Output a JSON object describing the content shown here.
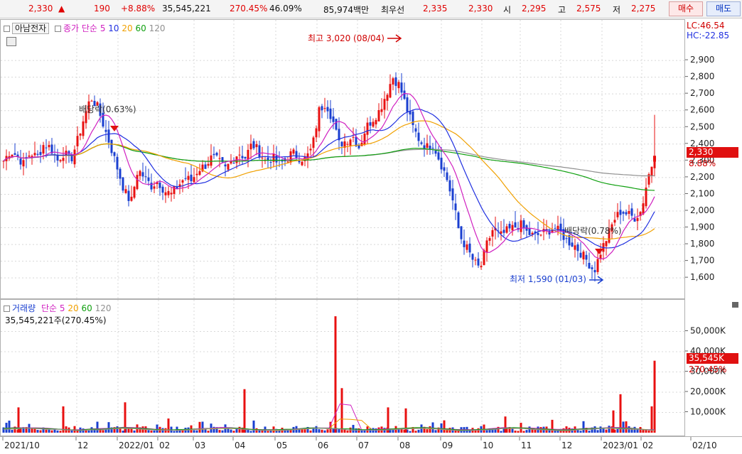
{
  "quote": {
    "price": "2,330",
    "arrow": "▲",
    "change": "190",
    "change_pct": "+8.88%",
    "volume": "35,545,221",
    "volume_ratio": "270.45%",
    "turnover_pct": "46.09%",
    "amount": "85,974백만",
    "best_ask_label": "최우선",
    "best_ask": "2,335",
    "best_bid": "2,330",
    "open_label": "시",
    "open": "2,295",
    "high_label": "고",
    "high": "2,575",
    "low_label": "저",
    "low": "2,275",
    "buy_button": "매수",
    "sell_button": "매도"
  },
  "price_pane": {
    "stock_name": "아남전자",
    "ma_label": "종가 단순",
    "ma_periods": [
      "5",
      "10",
      "20",
      "60",
      "120"
    ],
    "lc_text": "LC:46.54",
    "hc_text": "HC:-22.85",
    "high_marker": "최고 3,020 (08/04)",
    "low_marker": "최저 1,590 (01/03)",
    "dividend_1": "배당락(0.63%)",
    "dividend_2": "배당락(0.78%)",
    "current_price_tag": "2,330",
    "current_pct_tag": "8.88%"
  },
  "volume_pane": {
    "title": "거래량",
    "ma_label": "단순",
    "ma_periods": [
      "5",
      "20",
      "60",
      "120"
    ],
    "summary": "35,545,221주(270.45%)",
    "current_tag": "35,545K",
    "current_pct_tag": "270.45%"
  },
  "x_axis": {
    "labels": [
      "2021/10",
      "12",
      "2022/01",
      "02",
      "03",
      "04",
      "05",
      "06",
      "07",
      "08",
      "09",
      "10",
      "11",
      "12",
      "2023/01",
      "02",
      "02/10"
    ]
  },
  "colors": {
    "up": "#e81010",
    "down": "#1a3fd0",
    "ma5": "#d020c0",
    "ma10": "#2030e0",
    "ma20": "#f0a000",
    "ma60": "#10a010",
    "ma120": "#909090"
  },
  "chart_data": {
    "type": "candlestick",
    "y_ticks": [
      "2,900",
      "2,800",
      "2,700",
      "2,600",
      "2,500",
      "2,400",
      "2,300",
      "2,200",
      "2,100",
      "2,000",
      "1,900",
      "1,800",
      "1,700",
      "1,600"
    ],
    "ylim": [
      1520,
      3100
    ],
    "close_path": [
      2300,
      2360,
      2330,
      2280,
      2350,
      2320,
      2400,
      2380,
      2300,
      2350,
      2300,
      2420,
      2560,
      2680,
      2620,
      2500,
      2380,
      2250,
      2120,
      2050,
      2250,
      2200,
      2150,
      2180,
      2120,
      2100,
      2150,
      2200,
      2180,
      2250,
      2270,
      2320,
      2300,
      2250,
      2300,
      2350,
      2320,
      2400,
      2360,
      2300,
      2320,
      2280,
      2300,
      2350,
      2320,
      2310,
      2380,
      2600,
      2650,
      2550,
      2400,
      2420,
      2450,
      2380,
      2500,
      2550,
      2600,
      2700,
      2800,
      2750,
      2620,
      2500,
      2420,
      2380,
      2400,
      2300,
      2200,
      2050,
      1850,
      1780,
      1700,
      1650,
      1800,
      1900,
      1850,
      1880,
      1900,
      1920,
      1870,
      1850,
      1860,
      1880,
      1900,
      1870,
      1820,
      1800,
      1750,
      1700,
      1640,
      1760,
      1850,
      1950,
      2000,
      1980,
      1960,
      2000,
      2200,
      2330
    ],
    "volume_ticks": [
      "50,000K",
      "40,000K",
      "30,000K",
      "20,000K",
      "10,000K"
    ],
    "volume_ylim": [
      0,
      60000
    ],
    "volume_spikes": [
      {
        "x": 25,
        "v": 12500
      },
      {
        "x": 88,
        "v": 13000
      },
      {
        "x": 175,
        "v": 15000
      },
      {
        "x": 236,
        "v": 7000
      },
      {
        "x": 343,
        "v": 21500
      },
      {
        "x": 471,
        "v": 57500
      },
      {
        "x": 480,
        "v": 22000
      },
      {
        "x": 545,
        "v": 12500
      },
      {
        "x": 570,
        "v": 12000
      },
      {
        "x": 710,
        "v": 8000
      },
      {
        "x": 872,
        "v": 19000
      },
      {
        "x": 862,
        "v": 11000
      },
      {
        "x": 920,
        "v": 35545
      },
      {
        "x": 916,
        "v": 13000
      }
    ]
  }
}
